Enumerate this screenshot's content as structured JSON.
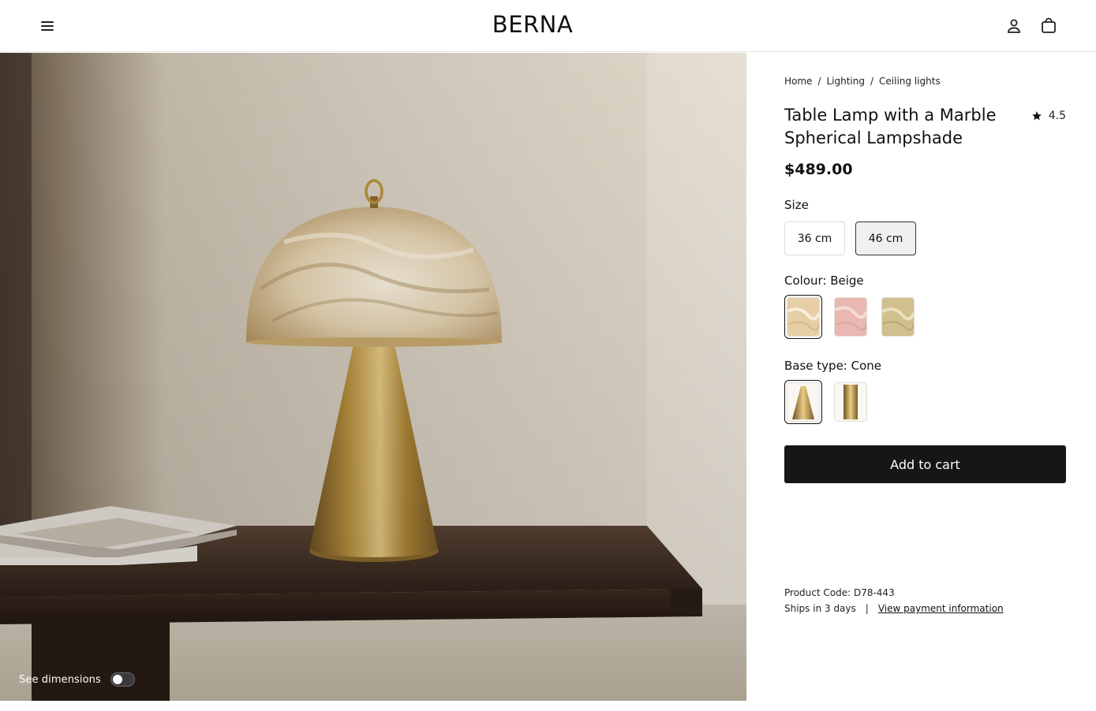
{
  "header": {
    "brand": "BERNA",
    "menu_icon": "hamburger-menu-icon",
    "account_icon": "user-icon",
    "cart_icon": "shopping-bag-icon"
  },
  "hero": {
    "toggle_label": "See dimensions",
    "toggle_on": false
  },
  "breadcrumb": {
    "items": [
      "Home",
      "Lighting",
      "Ceiling lights"
    ],
    "separator": "/"
  },
  "product": {
    "title": "Table Lamp with a Marble Spherical Lampshade",
    "rating_icon": "star-icon",
    "rating": "4.5",
    "price": "$489.00"
  },
  "size": {
    "label": "Size",
    "options": [
      "36 cm",
      "46 cm"
    ],
    "selected": "46 cm"
  },
  "colour": {
    "label": "Colour: Beige",
    "options": [
      {
        "name": "beige",
        "color": "#e6cfa6"
      },
      {
        "name": "pink",
        "color": "#e9b8b3"
      },
      {
        "name": "olive",
        "color": "#cfc08e"
      }
    ],
    "selected": "beige"
  },
  "base": {
    "label": "Base type: Cone",
    "options": [
      {
        "name": "cone",
        "color": "#b8913d"
      },
      {
        "name": "cylinder",
        "color": "#b8913d"
      }
    ],
    "selected": "cone"
  },
  "cart": {
    "button_label": "Add to cart"
  },
  "meta": {
    "product_code": "Product Code: D78-443",
    "shipping": "Ships in 3 days",
    "divider": "|",
    "payment_link": "View payment information"
  },
  "colors": {
    "accent": "#161616",
    "wall": "#d9d1c4",
    "table": "#3b2a20",
    "brass": "#b8913d",
    "marble": "#e8d7b8"
  }
}
